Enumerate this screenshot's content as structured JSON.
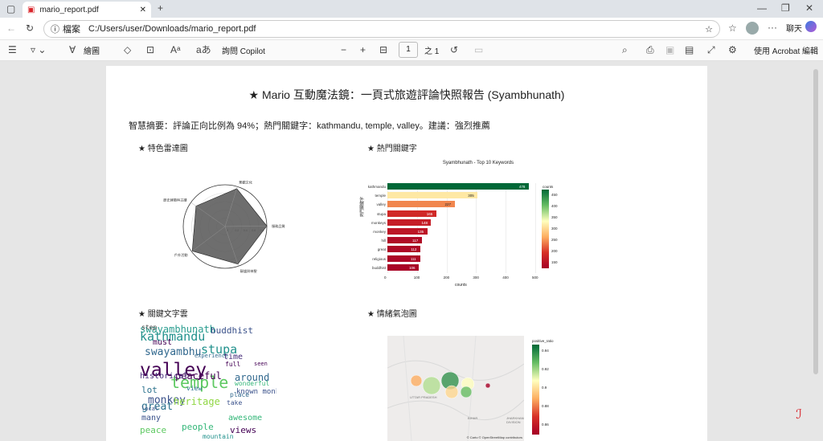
{
  "browser": {
    "tab_title": "mario_report.pdf",
    "url_prefix": "檔案",
    "url": "C:/Users/user/Downloads/mario_report.pdf",
    "chat_label": "聊天"
  },
  "toolbar": {
    "draw_label": "繪圖",
    "copilot_label": "詢問 Copilot",
    "page_number": "1",
    "page_total": "之 1",
    "acrobat_label": "使用 Acrobat 編輯"
  },
  "report": {
    "title": "★ Mario 互動魔法鏡：一頁式旅遊評論快照報告 (Syambhunath)",
    "summary": "智慧摘要：評論正向比例為 94%；熱門關鍵字：kathmandu, temple, valley。建議：強烈推薦",
    "sections": {
      "radar": "★ 特色雷達圖",
      "keywords": "★ 熱門關鍵字",
      "wordcloud": "★ 關鍵文字雲",
      "bubble": "★ 情緒氣泡圖"
    }
  },
  "radar": {
    "axes": [
      "景觀文化",
      "服務品質",
      "靜謐與神聖",
      "戶外活動",
      "歷史建築與古蹟"
    ],
    "ticks": [
      "0",
      "0.2",
      "0.4",
      "0.6",
      "0.8"
    ]
  },
  "chart_data": [
    {
      "type": "bar",
      "title": "Syambhunath - Top 10 Keywords",
      "xlabel": "counts",
      "ylabel": "熱門關鍵字",
      "categories": [
        "kathmandu",
        "temple",
        "valley",
        "stupa",
        "monkeys",
        "monkey",
        "hill",
        "great",
        "religious",
        "buddhist"
      ],
      "values": [
        478,
        305,
        227,
        165,
        148,
        135,
        117,
        112,
        111,
        106
      ],
      "xlim": [
        0,
        500
      ],
      "xticks": [
        "0",
        "100",
        "200",
        "300",
        "400",
        "500"
      ],
      "colorbar": {
        "title": "counts",
        "ticks": [
          "450",
          "400",
          "350",
          "300",
          "250",
          "200",
          "150"
        ]
      }
    },
    {
      "type": "scatter",
      "colorbar": {
        "title": "positive_ratio",
        "ticks": [
          "0.94",
          "0.92",
          "0.9",
          "0.88",
          "0.86"
        ]
      },
      "attribution": "© Carto © OpenStreetMap contributors",
      "map_labels": [
        "UTTAR PRADESH",
        "BIHAR",
        "JHARKHAND DIVISION"
      ]
    }
  ],
  "wordcloud": {
    "words": [
      "swayambhunath",
      "kathmandu",
      "valley",
      "buddhist",
      "stupa",
      "swayambhu",
      "temple",
      "monkey",
      "people",
      "peaceful",
      "heritage",
      "great",
      "around",
      "historical",
      "many",
      "must",
      "lot",
      "peace",
      "awesome",
      "mountain",
      "known monkey",
      "views",
      "experience",
      "time",
      "take",
      "full",
      "wonderful",
      "local",
      "view",
      "place",
      "seen",
      "step"
    ]
  }
}
